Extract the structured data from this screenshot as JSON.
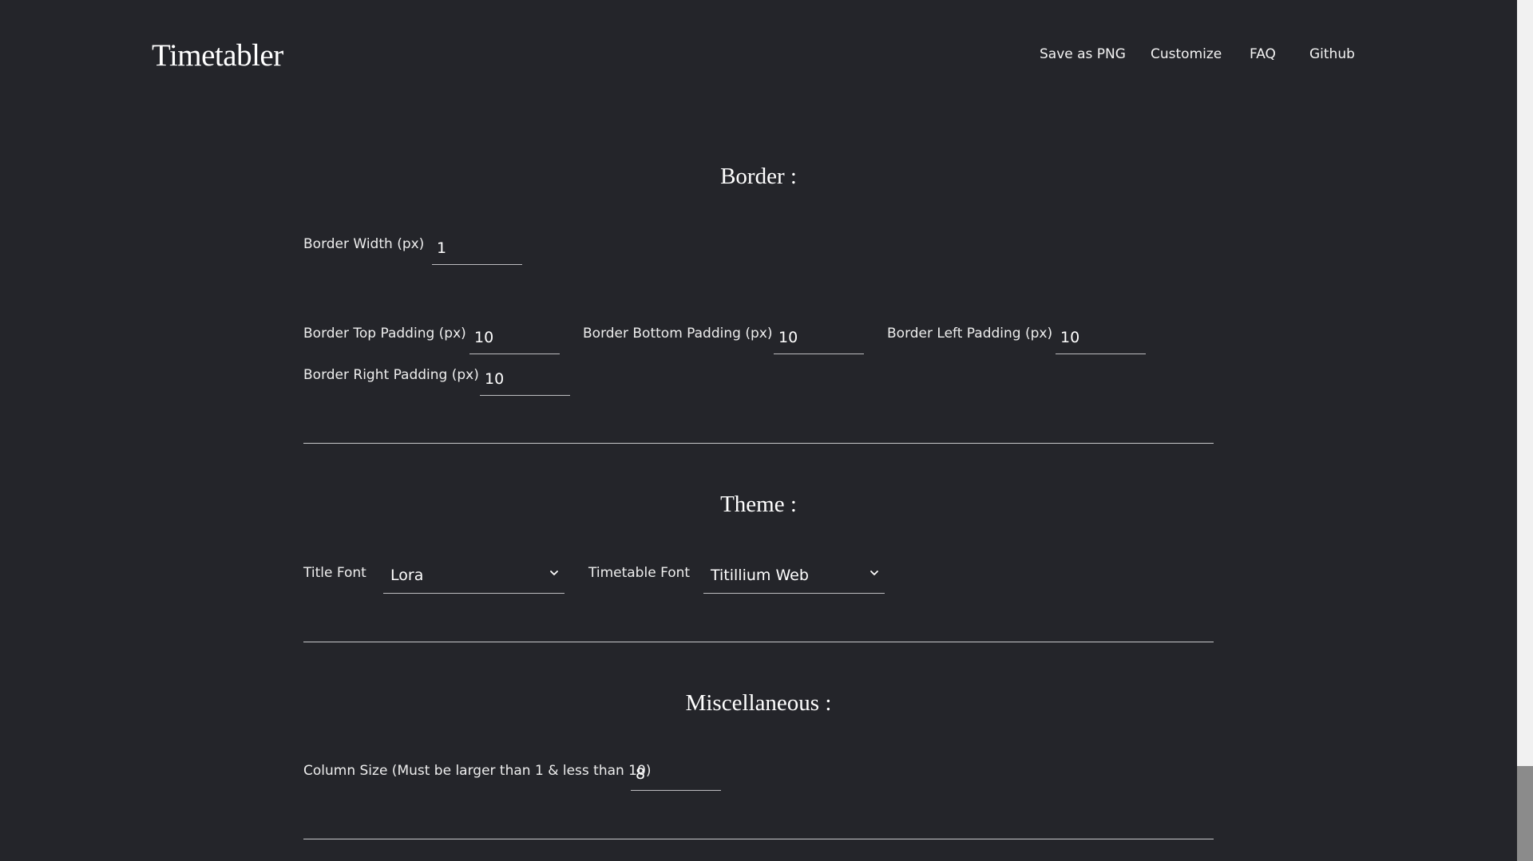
{
  "header": {
    "brand": "Timetabler",
    "nav": [
      "Save as PNG",
      "Customize",
      "FAQ",
      "Github"
    ]
  },
  "border": {
    "title": "Border :",
    "width_label": "Border Width (px)",
    "width_value": "1",
    "top_label": "Border Top Padding (px)",
    "top_value": "10",
    "bottom_label": "Border Bottom Padding (px)",
    "bottom_value": "10",
    "left_label": "Border Left Padding (px)",
    "left_value": "10",
    "right_label": "Border Right Padding (px)",
    "right_value": "10"
  },
  "theme": {
    "title": "Theme :",
    "title_font_label": "Title Font",
    "title_font_value": "Lora",
    "timetable_font_label": "Timetable Font",
    "timetable_font_value": "Titillium Web"
  },
  "misc": {
    "title": "Miscellaneous :",
    "column_label": "Column Size (Must be larger than 1 & less than 10)",
    "column_value": "8"
  },
  "colors": {
    "background": "#24252a",
    "text": "#ffffff",
    "divider": "#c9c9cc"
  },
  "icons": {
    "select_arrow": "chevron-down-icon"
  }
}
